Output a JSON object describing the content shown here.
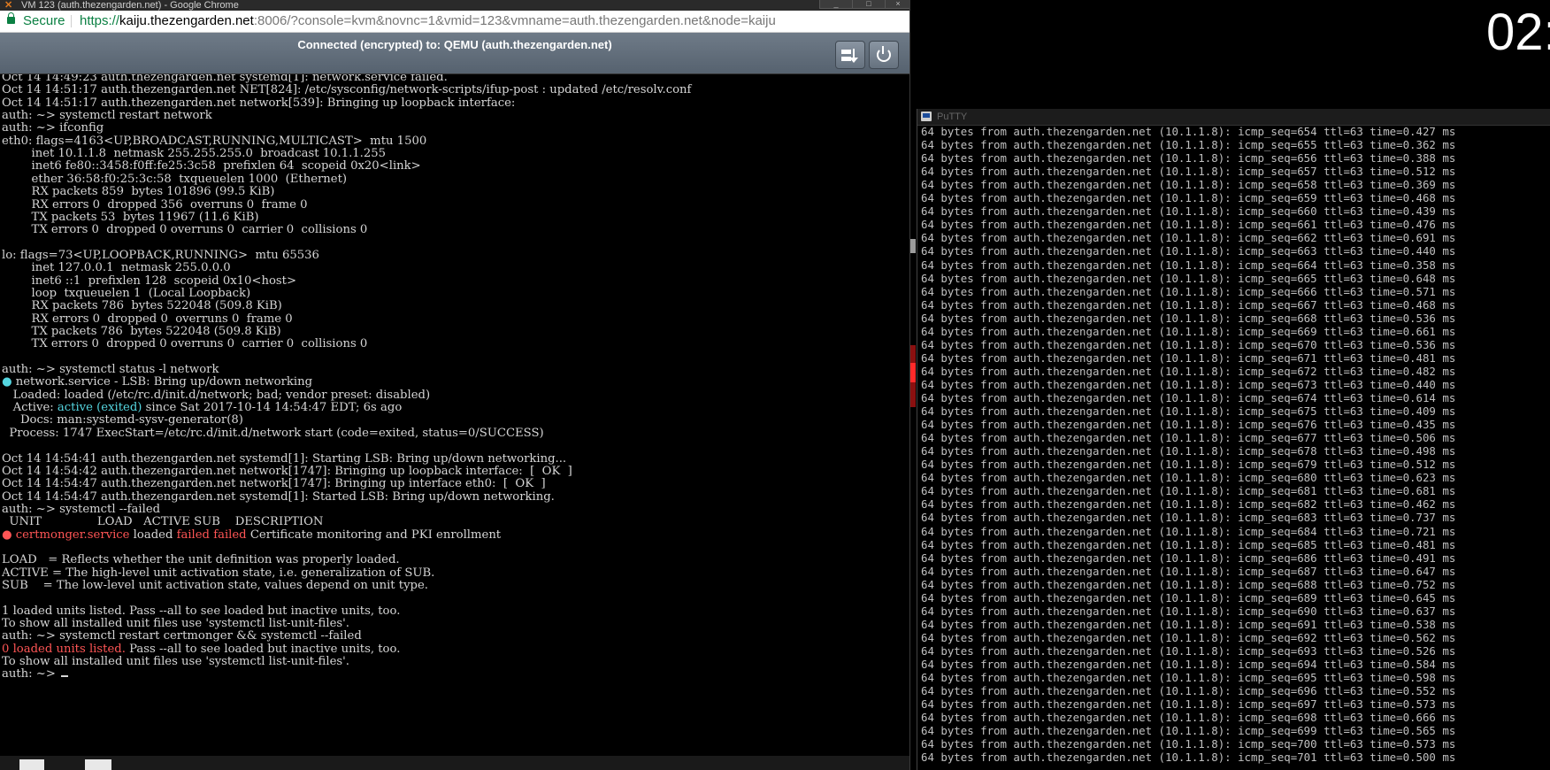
{
  "chrome": {
    "title": "VM 123 (auth.thezengarden.net) - Google Chrome",
    "window_buttons": [
      "_",
      "□",
      "×"
    ],
    "secure_label": "Secure",
    "url_scheme": "https://",
    "url_host": "kaiju.thezengarden.net",
    "url_rest": ":8006/?console=kvm&novnc=1&vmid=123&vmname=auth.thezengarden.net&node=kaiju"
  },
  "novnc": {
    "status": "Connected (encrypted) to: QEMU (auth.thezengarden.net)",
    "settings_icon": "settings-icon",
    "power_icon": "power-icon"
  },
  "console": {
    "lines": [
      [
        {
          "t": "Oct 14 14:49:23 auth.thezengarden.net systemd[1]: network.service failed."
        }
      ],
      [
        {
          "t": "Oct 14 14:51:17 auth.thezengarden.net NET[824]: /etc/sysconfig/network-scripts/ifup-post : updated /etc/resolv.conf"
        }
      ],
      [
        {
          "t": "Oct 14 14:51:17 auth.thezengarden.net network[539]: Bringing up loopback interface:"
        }
      ],
      [
        {
          "t": "auth: ~> systemctl restart network"
        }
      ],
      [
        {
          "t": "auth: ~> ifconfig"
        }
      ],
      [
        {
          "t": "eth0: flags=4163<UP,BROADCAST,RUNNING,MULTICAST>  mtu 1500"
        }
      ],
      [
        {
          "t": "        inet 10.1.1.8  netmask 255.255.255.0  broadcast 10.1.1.255"
        }
      ],
      [
        {
          "t": "        inet6 fe80::3458:f0ff:fe25:3c58  prefixlen 64  scopeid 0x20<link>"
        }
      ],
      [
        {
          "t": "        ether 36:58:f0:25:3c:58  txqueuelen 1000  (Ethernet)"
        }
      ],
      [
        {
          "t": "        RX packets 859  bytes 101896 (99.5 KiB)"
        }
      ],
      [
        {
          "t": "        RX errors 0  dropped 356  overruns 0  frame 0"
        }
      ],
      [
        {
          "t": "        TX packets 53  bytes 11967 (11.6 KiB)"
        }
      ],
      [
        {
          "t": "        TX errors 0  dropped 0 overruns 0  carrier 0  collisions 0"
        }
      ],
      [
        {
          "t": ""
        }
      ],
      [
        {
          "t": "lo: flags=73<UP,LOOPBACK,RUNNING>  mtu 65536"
        }
      ],
      [
        {
          "t": "        inet 127.0.0.1  netmask 255.0.0.0"
        }
      ],
      [
        {
          "t": "        inet6 ::1  prefixlen 128  scopeid 0x10<host>"
        }
      ],
      [
        {
          "t": "        loop  txqueuelen 1  (Local Loopback)"
        }
      ],
      [
        {
          "t": "        RX packets 786  bytes 522048 (509.8 KiB)"
        }
      ],
      [
        {
          "t": "        RX errors 0  dropped 0  overruns 0  frame 0"
        }
      ],
      [
        {
          "t": "        TX packets 786  bytes 522048 (509.8 KiB)"
        }
      ],
      [
        {
          "t": "        TX errors 0  dropped 0 overruns 0  carrier 0  collisions 0"
        }
      ],
      [
        {
          "t": ""
        }
      ],
      [
        {
          "t": "auth: ~> systemctl status -l network"
        }
      ],
      [
        {
          "t": "●",
          "c": "c-bullet"
        },
        {
          "t": " network.service - LSB: Bring up/down networking"
        }
      ],
      [
        {
          "t": "   Loaded: loaded (/etc/rc.d/init.d/network; bad; vendor preset: disabled)"
        }
      ],
      [
        {
          "t": "   Active: "
        },
        {
          "t": "active (exited)",
          "c": "c-cyan"
        },
        {
          "t": " since Sat 2017-10-14 14:54:47 EDT; 6s ago"
        }
      ],
      [
        {
          "t": "     Docs: man:systemd-sysv-generator(8)"
        }
      ],
      [
        {
          "t": "  Process: 1747 ExecStart=/etc/rc.d/init.d/network start (code=exited, status=0/SUCCESS)"
        }
      ],
      [
        {
          "t": ""
        }
      ],
      [
        {
          "t": "Oct 14 14:54:41 auth.thezengarden.net systemd[1]: Starting LSB: Bring up/down networking..."
        }
      ],
      [
        {
          "t": "Oct 14 14:54:42 auth.thezengarden.net network[1747]: Bringing up loopback interface:  [  OK  ]"
        }
      ],
      [
        {
          "t": "Oct 14 14:54:47 auth.thezengarden.net network[1747]: Bringing up interface eth0:  [  OK  ]"
        }
      ],
      [
        {
          "t": "Oct 14 14:54:47 auth.thezengarden.net systemd[1]: Started LSB: Bring up/down networking."
        }
      ],
      [
        {
          "t": "auth: ~> systemctl --failed"
        }
      ],
      [
        {
          "t": "  UNIT               LOAD   ACTIVE SUB    DESCRIPTION"
        }
      ],
      [
        {
          "t": "●",
          "c": "c-redbullet"
        },
        {
          "t": " "
        },
        {
          "t": "certmonger.service",
          "c": "c-red"
        },
        {
          "t": " loaded "
        },
        {
          "t": "failed failed",
          "c": "c-red"
        },
        {
          "t": " Certificate monitoring and PKI enrollment"
        }
      ],
      [
        {
          "t": ""
        }
      ],
      [
        {
          "t": "LOAD   = Reflects whether the unit definition was properly loaded."
        }
      ],
      [
        {
          "t": "ACTIVE = The high-level unit activation state, i.e. generalization of SUB."
        }
      ],
      [
        {
          "t": "SUB    = The low-level unit activation state, values depend on unit type."
        }
      ],
      [
        {
          "t": ""
        }
      ],
      [
        {
          "t": "1 loaded units listed. Pass --all to see loaded but inactive units, too."
        }
      ],
      [
        {
          "t": "To show all installed unit files use 'systemctl list-unit-files'."
        }
      ],
      [
        {
          "t": "auth: ~> systemctl restart certmonger && systemctl --failed"
        }
      ],
      [
        {
          "t": "0 loaded units listed.",
          "c": "c-red"
        },
        {
          "t": " Pass --all to see loaded but inactive units, too."
        }
      ],
      [
        {
          "t": "To show all installed unit files use 'systemctl list-unit-files'."
        }
      ],
      [
        {
          "t": "auth: ~> "
        }
      ]
    ]
  },
  "clock": {
    "text": "02:"
  },
  "putty": {
    "title": "PuTTY",
    "line_prefix": "64 bytes from auth.thezengarden.net (10.1.1.8): icmp_seq=",
    "ttl_part": " ttl=63 time=",
    "unit": " ms",
    "pings": [
      [
        "654",
        "0.427"
      ],
      [
        "655",
        "0.362"
      ],
      [
        "656",
        "0.388"
      ],
      [
        "657",
        "0.512"
      ],
      [
        "658",
        "0.369"
      ],
      [
        "659",
        "0.468"
      ],
      [
        "660",
        "0.439"
      ],
      [
        "661",
        "0.476"
      ],
      [
        "662",
        "0.691"
      ],
      [
        "663",
        "0.440"
      ],
      [
        "664",
        "0.358"
      ],
      [
        "665",
        "0.648"
      ],
      [
        "666",
        "0.571"
      ],
      [
        "667",
        "0.468"
      ],
      [
        "668",
        "0.536"
      ],
      [
        "669",
        "0.661"
      ],
      [
        "670",
        "0.536"
      ],
      [
        "671",
        "0.481"
      ],
      [
        "672",
        "0.482"
      ],
      [
        "673",
        "0.440"
      ],
      [
        "674",
        "0.614"
      ],
      [
        "675",
        "0.409"
      ],
      [
        "676",
        "0.435"
      ],
      [
        "677",
        "0.506"
      ],
      [
        "678",
        "0.498"
      ],
      [
        "679",
        "0.512"
      ],
      [
        "680",
        "0.623"
      ],
      [
        "681",
        "0.681"
      ],
      [
        "682",
        "0.462"
      ],
      [
        "683",
        "0.737"
      ],
      [
        "684",
        "0.721"
      ],
      [
        "685",
        "0.481"
      ],
      [
        "686",
        "0.491"
      ],
      [
        "687",
        "0.647"
      ],
      [
        "688",
        "0.752"
      ],
      [
        "689",
        "0.645"
      ],
      [
        "690",
        "0.637"
      ],
      [
        "691",
        "0.538"
      ],
      [
        "692",
        "0.562"
      ],
      [
        "693",
        "0.526"
      ],
      [
        "694",
        "0.584"
      ],
      [
        "695",
        "0.598"
      ],
      [
        "696",
        "0.552"
      ],
      [
        "697",
        "0.573"
      ],
      [
        "698",
        "0.666"
      ],
      [
        "699",
        "0.565"
      ],
      [
        "700",
        "0.573"
      ],
      [
        "701",
        "0.500"
      ]
    ]
  }
}
